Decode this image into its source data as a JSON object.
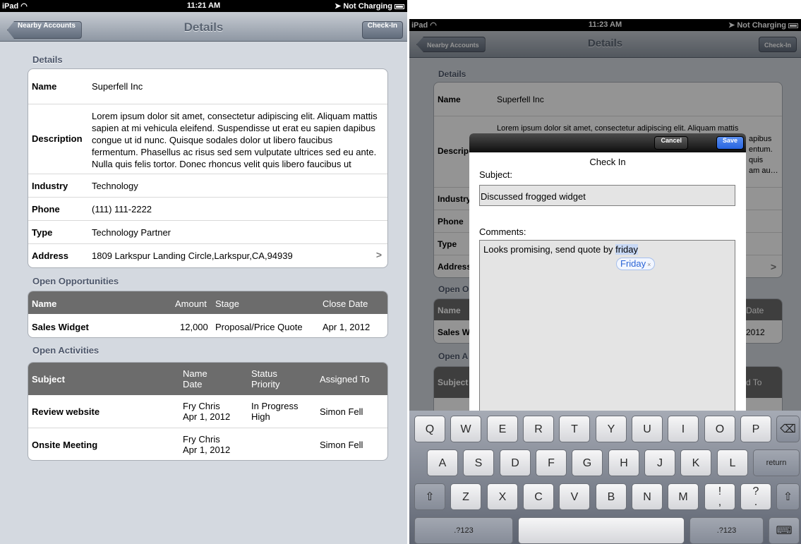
{
  "left": {
    "status": {
      "carrier": "iPad",
      "time": "11:21 AM",
      "charging": "Not Charging"
    },
    "nav": {
      "back": "Nearby Accounts",
      "title": "Details",
      "action": "Check-In"
    },
    "details": {
      "heading": "Details",
      "rows": [
        {
          "label": "Name",
          "value": "Superfell Inc"
        },
        {
          "label": "Description",
          "value": "Lorem ipsum dolor sit amet, consectetur adipiscing elit. Aliquam mattis sapien at mi vehicula eleifend. Suspendisse ut erat eu sapien dapibus congue ut id nunc. Quisque sodales dolor ut libero faucibus fermentum. Phasellus ac risus sed sem vulputate ultrices sed eu ante. Nulla quis felis tortor. Donec rhoncus velit quis libero faucibus ut gravida diam au…"
        },
        {
          "label": "Industry",
          "value": "Technology"
        },
        {
          "label": "Phone",
          "value": "(111) 111-2222"
        },
        {
          "label": "Type",
          "value": "Technology Partner"
        },
        {
          "label": "Address",
          "value": "1809 Larkspur Landing Circle,Larkspur,CA,94939",
          "chevron": ">"
        }
      ]
    },
    "opportunities": {
      "heading": "Open Opportunities",
      "columns": {
        "name": "Name",
        "amount": "Amount",
        "stage": "Stage",
        "close": "Close Date"
      },
      "rows": [
        {
          "name": "Sales Widget",
          "amount": "12,000",
          "stage": "Proposal/Price Quote",
          "close": "Apr 1, 2012"
        }
      ]
    },
    "activities": {
      "heading": "Open Activities",
      "columns": {
        "subject": "Subject",
        "name": "Name",
        "date": "Date",
        "status": "Status",
        "priority": "Priority",
        "assigned": "Assigned To"
      },
      "rows": [
        {
          "subject": "Review website",
          "name": "Fry Chris",
          "date": "Apr 1, 2012",
          "status": "In Progress",
          "priority": "High",
          "assigned": "Simon Fell"
        },
        {
          "subject": "Onsite Meeting",
          "name": "Fry Chris",
          "date": "Apr 1, 2012",
          "status": "",
          "priority": "",
          "assigned": "Simon Fell"
        }
      ]
    }
  },
  "right": {
    "status": {
      "carrier": "iPad",
      "time": "11:23 AM",
      "charging": "Not Charging"
    },
    "nav": {
      "back": "Nearby Accounts",
      "title": "Details",
      "action": "Check-In"
    },
    "bg": {
      "heading": "Details",
      "name_label": "Name",
      "name_value": "Superfell Inc",
      "desc_label": "Descrip",
      "desc_line1": "Lorem ipsum dolor sit amet, consectetur adipiscing elit. Aliquam mattis",
      "desc_r2": "apibus",
      "desc_r3": "entum.",
      "desc_r4": "quis",
      "desc_r5": "am au…",
      "industry": "Industry",
      "phone": "Phone",
      "type": "Type",
      "address": "Address",
      "chev": ">",
      "opp_head": "Open O",
      "opp_name": "Name",
      "opp_date": "Date",
      "opp_row": "Sales W",
      "opp_year": "2012",
      "act_head": "Open A",
      "act_subject": "Subject",
      "act_assigned": "d To"
    },
    "dialog": {
      "cancel": "Cancel",
      "save": "Save",
      "title": "Check In",
      "subject_label": "Subject:",
      "subject_value": "Discussed frogged widget",
      "comments_label": "Comments:",
      "comments_text": "Looks promising, send quote by ",
      "comments_highlight": "friday",
      "suggestion": "Friday",
      "suggestion_close": "×"
    },
    "keyboard": {
      "row1": [
        "Q",
        "W",
        "E",
        "R",
        "T",
        "Y",
        "U",
        "I",
        "O",
        "P"
      ],
      "row2": [
        "A",
        "S",
        "D",
        "F",
        "G",
        "H",
        "J",
        "K",
        "L"
      ],
      "row3": [
        "Z",
        "X",
        "C",
        "V",
        "B",
        "N",
        "M"
      ],
      "backspace": "⌫",
      "return": "return",
      "shift": "⇧",
      "punct1_top": "!",
      "punct1_bottom": ",",
      "punct2_top": "?",
      "punct2_bottom": ".",
      "numbers": ".?123",
      "hide": "⌨"
    }
  }
}
